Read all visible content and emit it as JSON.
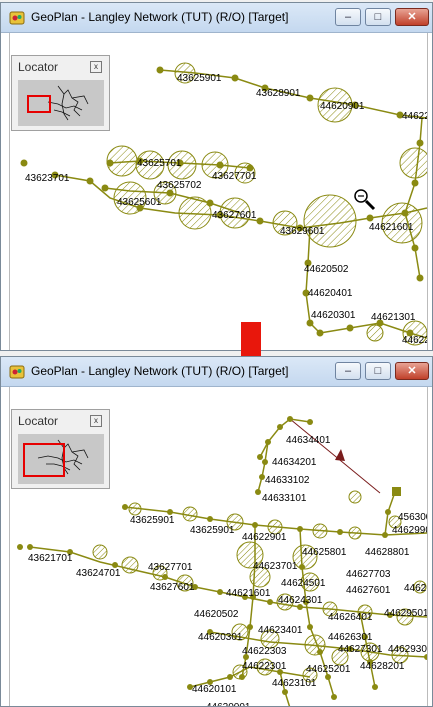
{
  "window": {
    "title": "GeoPlan - Langley Network (TUT) (R/O) [Target]",
    "minimize": "–",
    "maximize": "□",
    "close": "✕"
  },
  "locator": {
    "title": "Locator",
    "close": "x"
  },
  "colors": {
    "node": "#8a8a12",
    "pipe": "#8a8a12",
    "arrow": "#e8170c",
    "frame": "#e60000",
    "link": "#7a1c1c"
  },
  "top_labels": [
    "43625901",
    "43628901",
    "44620901",
    "44622",
    "43625701",
    "43623701",
    "43625702",
    "43627701",
    "43625601",
    "43627601",
    "43629601",
    "44621601",
    "44620502",
    "44620401",
    "44620301",
    "44621301",
    "44622"
  ],
  "bottom_labels": [
    "44634401",
    "44634201",
    "44633102",
    "44633101",
    "4563009",
    "44629901",
    "43625901",
    "43625901",
    "44622901",
    "44625801",
    "44628801",
    "43621701",
    "43627701",
    "43624701",
    "44623701",
    "44627703",
    "43627601",
    "44624501",
    "44627601",
    "44621601",
    "4462",
    "44620502",
    "44624301",
    "44626401",
    "44629501",
    "44620301",
    "44623401",
    "44626301",
    "44627301",
    "44629306",
    "44622303",
    "44628201",
    "44622301",
    "44625201",
    "44623101",
    "44620101",
    "44620001",
    "44614901",
    "44616001"
  ]
}
